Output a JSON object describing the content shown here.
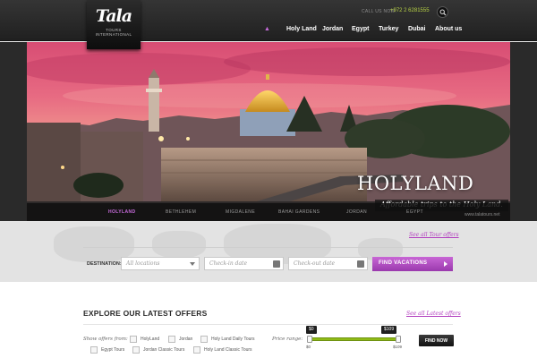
{
  "brand": {
    "logo_text": "Tala",
    "logo_subtitle": "TOURS INTERNATIONAL"
  },
  "header": {
    "call_label": "CALL US NOW:",
    "phone": "+972 2 6281555"
  },
  "nav": {
    "items": [
      "Holy Land",
      "Jordan",
      "Egypt",
      "Turkey",
      "Dubai",
      "About us"
    ],
    "home_icon": "home-icon"
  },
  "hero": {
    "title": "HOLYLAND",
    "subtitle": "Affordable trips to the Holy Land.",
    "credit": "www.talatours.net",
    "tabs": [
      "HOLYLAND",
      "BETHLEHEM",
      "MIGDALENE",
      "BAHAI GARDENS",
      "JORDAN",
      "EGYPT"
    ],
    "active_tab": "HOLYLAND"
  },
  "search": {
    "see_all": "See all Tour offers",
    "destination_label": "DESTINATION:",
    "location_value": "All locations",
    "checkin_placeholder": "Check-in date",
    "checkout_placeholder": "Check-out date",
    "button": "FIND VACATIONS"
  },
  "offers": {
    "title": "EXPLORE OUR LATEST OFFERS",
    "see_all": "See all Latest offers",
    "show_label": "Show offers from:",
    "filters": [
      "HolyLand",
      "Jordan",
      "Holy Land Daily Tours",
      "Egypt Tours",
      "Jordan Classic Tours",
      "Holy Land Classic Tours"
    ],
    "price_label": "Price range:",
    "price_min": "$0",
    "price_max": "$109",
    "slider_min_label": "$0",
    "slider_max_label": "$109",
    "button": "FIND NOW"
  },
  "colors": {
    "accent": "#b23fbf",
    "slider": "#8fbb16",
    "phone": "#b7d244"
  }
}
